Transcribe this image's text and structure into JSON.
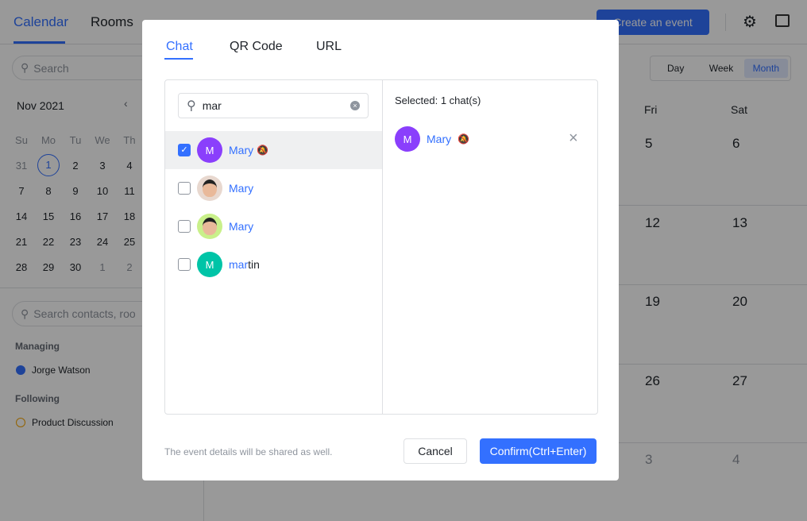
{
  "topbar": {
    "tabs": [
      "Calendar",
      "Rooms"
    ],
    "create_event": "Create an event",
    "icons": [
      "gear-icon",
      "window-icon"
    ]
  },
  "sidebar": {
    "search_placeholder": "Search",
    "month": "Nov 2021",
    "weekdays": [
      "Su",
      "Mo",
      "Tu",
      "We",
      "Th"
    ],
    "weeks": [
      [
        "31",
        "1",
        "2",
        "3",
        "4"
      ],
      [
        "7",
        "8",
        "9",
        "10",
        "11"
      ],
      [
        "14",
        "15",
        "16",
        "17",
        "18"
      ],
      [
        "21",
        "22",
        "23",
        "24",
        "25"
      ],
      [
        "28",
        "29",
        "30",
        "1",
        "2"
      ]
    ],
    "contacts_placeholder": "Search contacts, roo",
    "managing_label": "Managing",
    "managing": "Jorge Watson",
    "following_label": "Following",
    "following": "Product Discussion"
  },
  "view": {
    "options": [
      "Day",
      "Week",
      "Month"
    ],
    "selected": "Month",
    "columns": [
      "Fri",
      "Sat"
    ],
    "dates": [
      [
        "5",
        "6"
      ],
      [
        "12",
        "13"
      ],
      [
        "19",
        "20"
      ],
      [
        "26",
        "27"
      ],
      [
        "3",
        "4"
      ]
    ]
  },
  "modal": {
    "tabs": [
      "Chat",
      "QR Code",
      "URL"
    ],
    "active_tab": "Chat",
    "search_value": "mar",
    "results": [
      {
        "match": "Mary",
        "rest": "",
        "avatar": "M",
        "color": "#8a3ffc",
        "checked": true,
        "muted": true
      },
      {
        "match": "Mary",
        "rest": "",
        "avatar": "photo",
        "color": "#e8d8cf",
        "checked": false,
        "muted": false
      },
      {
        "match": "Mary",
        "rest": "",
        "avatar": "photo",
        "color": "#c9f08a",
        "checked": false,
        "muted": false
      },
      {
        "match": "mar",
        "rest": "tin",
        "avatar": "M",
        "color": "#00c4a7",
        "checked": false,
        "muted": false
      }
    ],
    "selected_label": "Selected: 1 chat(s)",
    "selected_name": "Mary",
    "selected_avatar": "M",
    "footer_note": "The event details will be shared as well.",
    "cancel": "Cancel",
    "confirm": "Confirm(Ctrl+Enter)"
  },
  "colors": {
    "accent": "#3370ff"
  }
}
